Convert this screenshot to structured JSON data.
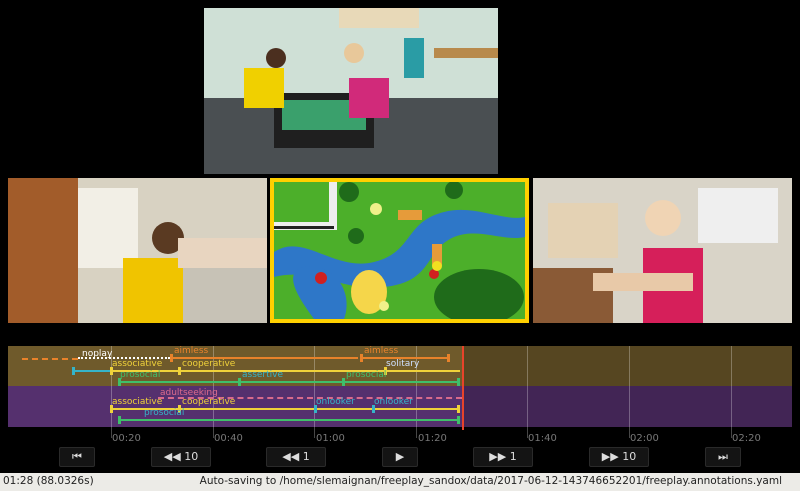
{
  "timeline": {
    "ticks": [
      "00:20",
      "00:40",
      "01:00",
      "01:20",
      "01:40",
      "02:00",
      "02:20"
    ],
    "labels": {
      "noplay": "noplay",
      "aimless1": "aimless",
      "aimless2": "aimless",
      "associative_a": "associative",
      "cooperative_a": "cooperative",
      "solitary": "solitary",
      "prosocial_a1": "prosocial",
      "assertive": "assertive",
      "prosocial_a2": "prosocial",
      "adultseeking": "adultseeking",
      "associative_b": "associative",
      "cooperative_b": "cooperative",
      "onlooker1": "onlooker",
      "onlooker2": "onlooker",
      "prosocial_b": "prosocial"
    },
    "colors": {
      "track_a": "#6f5a2b",
      "track_b": "#55306e",
      "playhead": "#e8432a",
      "orange": "#e8822a",
      "yellow": "#f0d23a",
      "green": "#3fbf6a",
      "teal": "#35b4c8",
      "pink": "#d96a8c",
      "white": "#ffffff"
    }
  },
  "controls": {
    "to_start": "⏮",
    "back_10": "◀◀ 10",
    "back_1": "◀◀ 1",
    "play": "▶",
    "fwd_1": "▶▶ 1",
    "fwd_10": "▶▶ 10",
    "to_end": "⏭"
  },
  "status": {
    "time": "01:28 (88.0326s)",
    "message": "Auto-saving to /home/slemaignan/freeplay_sandox/data/2017-06-12-143746652201/freeplay.annotations.yaml"
  }
}
